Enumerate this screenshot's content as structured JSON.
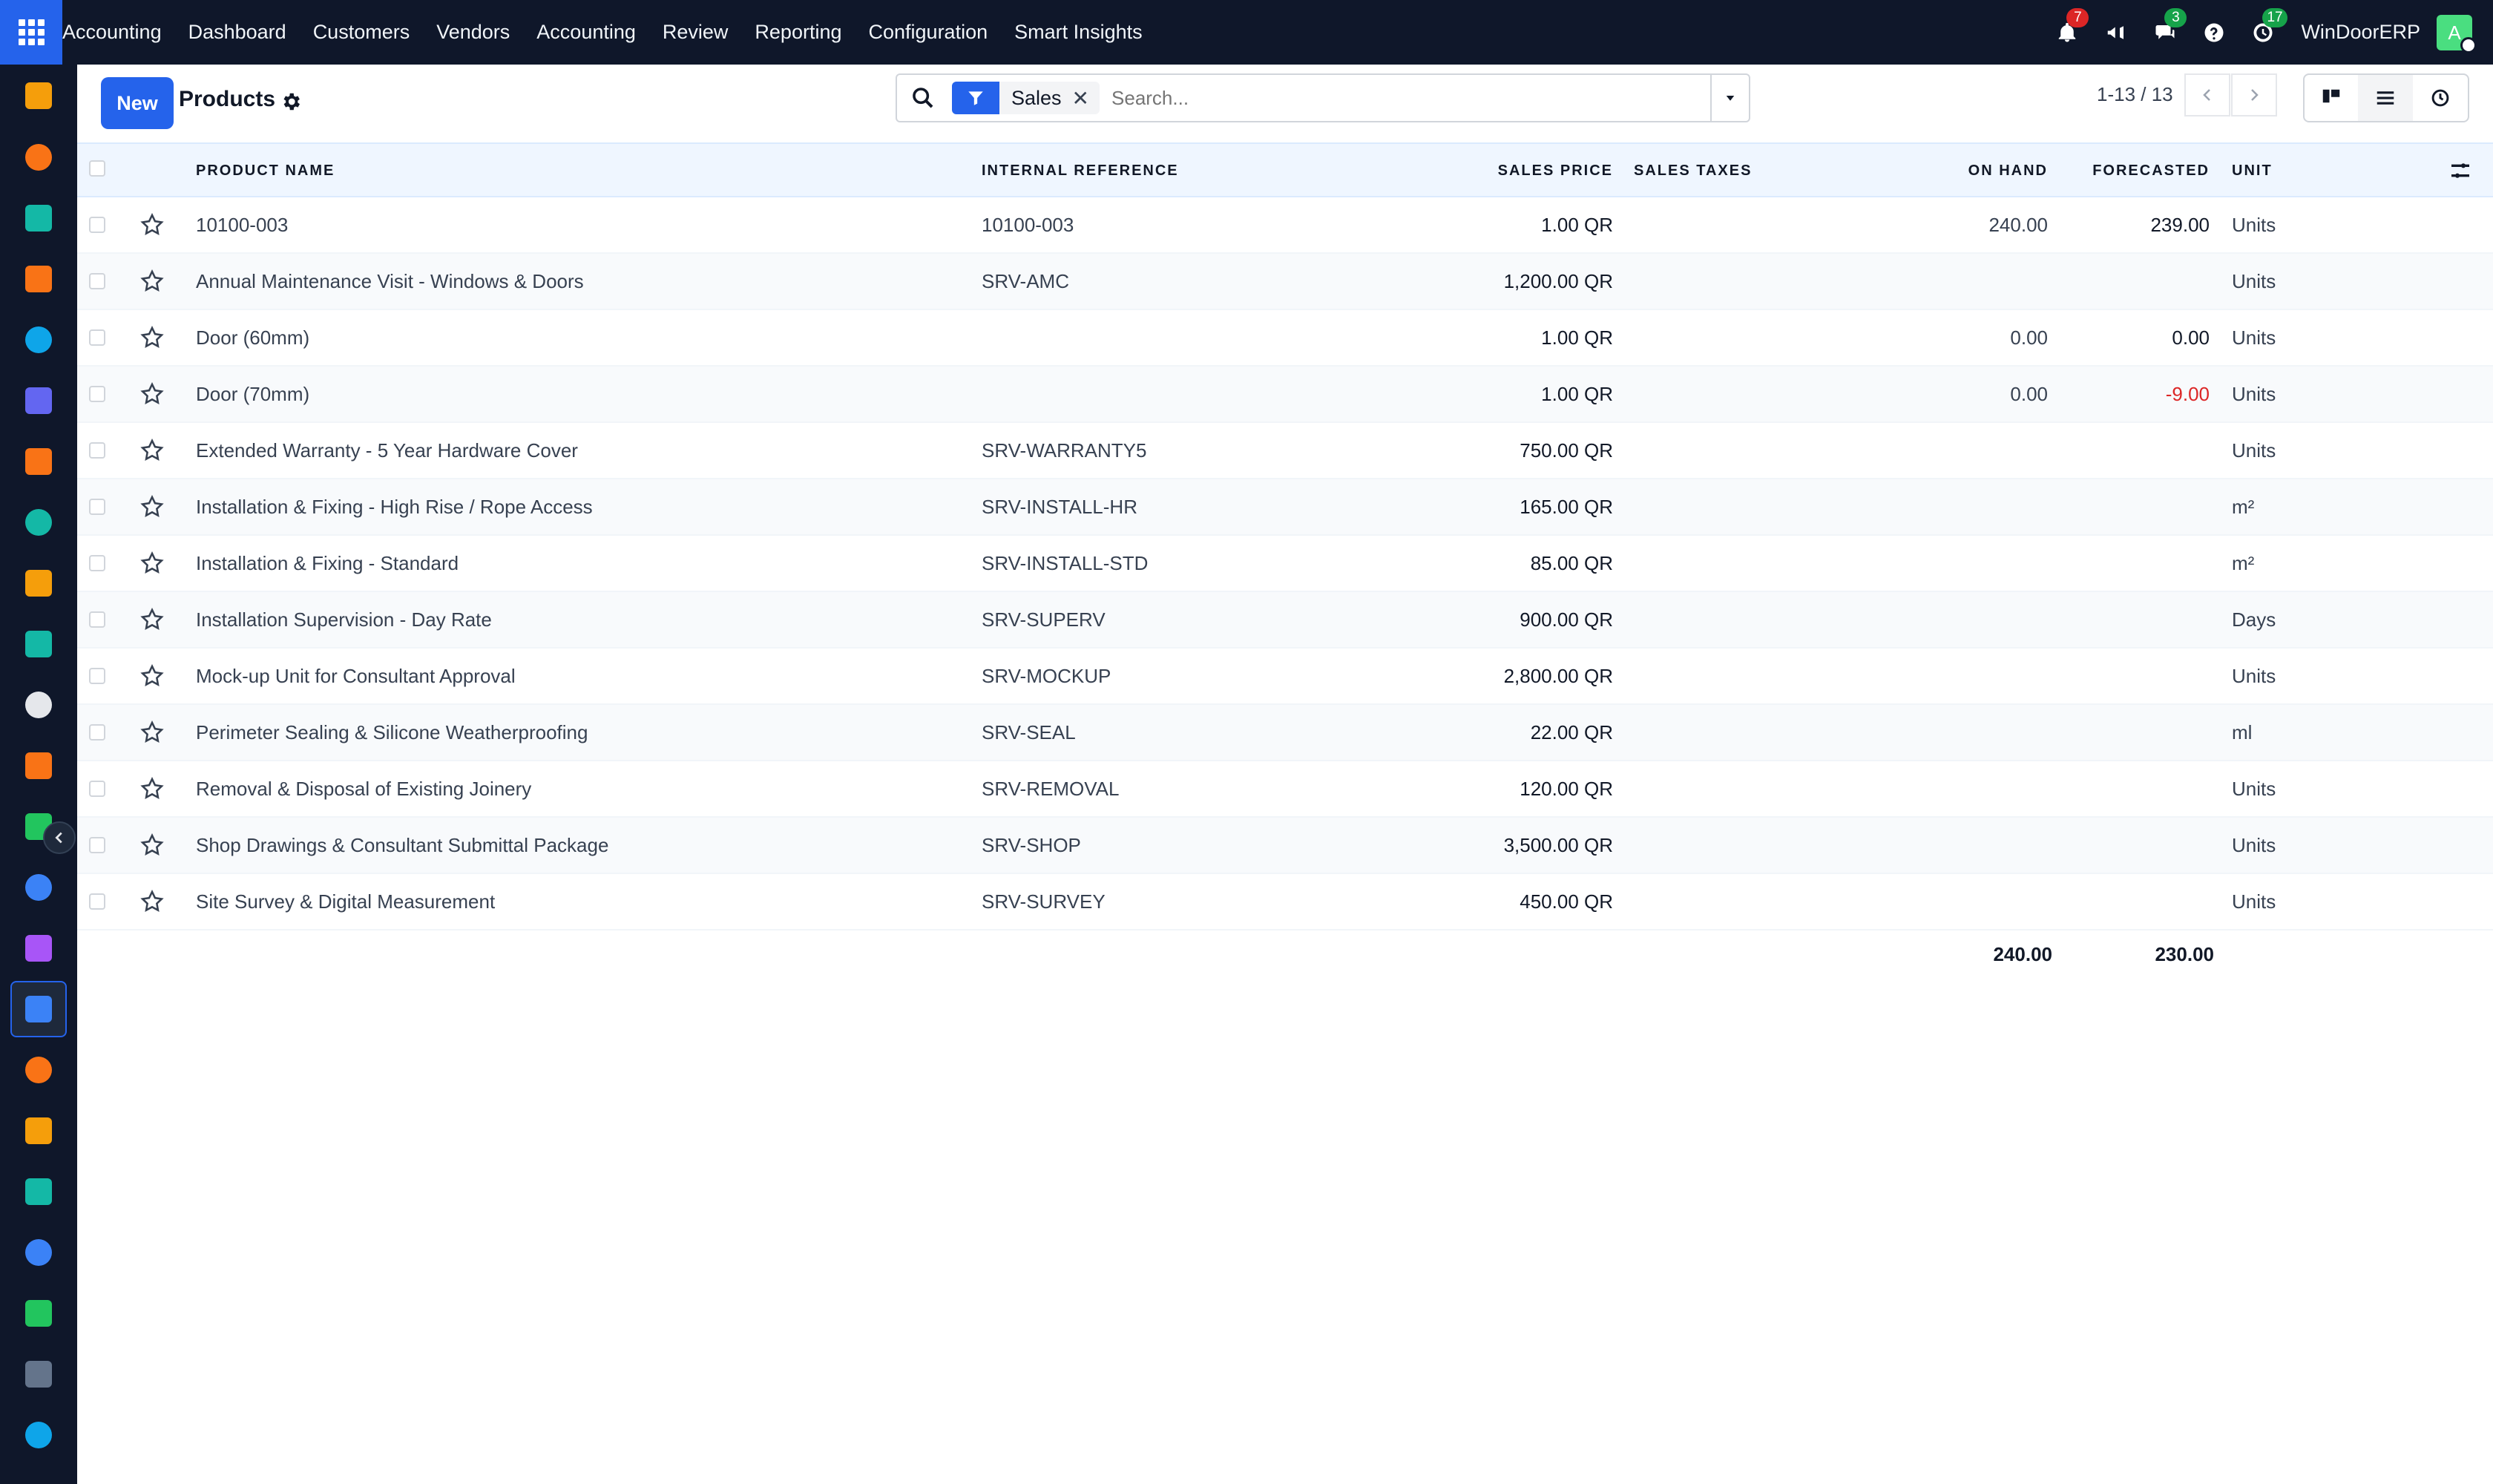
{
  "topbar": {
    "brand": "Accounting",
    "menu": [
      "Dashboard",
      "Customers",
      "Vendors",
      "Accounting",
      "Review",
      "Reporting",
      "Configuration",
      "Smart Insights"
    ],
    "notifications_count": "7",
    "messages_count": "3",
    "activities_count": "17",
    "company": "WinDoorERP",
    "avatar_letter": "A"
  },
  "sidebar": {
    "icons": [
      "accounting-icon",
      "studio-icon",
      "contacts-icon",
      "discuss-icon",
      "odoo-icon",
      "mail-icon",
      "chat-icon",
      "project-icon",
      "reporting-icon",
      "contacts-icon",
      "inventory-icon",
      "settings-icon",
      "todo-icon",
      "knowledge-icon",
      "package-icon",
      "invoicing-icon",
      "employees-icon",
      "calendar-icon",
      "sign-icon",
      "dashboards-icon",
      "whatsapp-icon",
      "timer-icon",
      "app-icon"
    ],
    "colors": [
      "#f59e0b",
      "#f97316",
      "#14b8a6",
      "#f97316",
      "#0ea5e9",
      "#6366f1",
      "#f97316",
      "#14b8a6",
      "#f59e0b",
      "#14b8a6",
      "#e5e7eb",
      "#f97316",
      "#22c55e",
      "#3b82f6",
      "#a855f7",
      "#3b82f6",
      "#f97316",
      "#f59e0b",
      "#14b8a6",
      "#3b82f6",
      "#22c55e",
      "#64748b",
      "#0ea5e9"
    ]
  },
  "control": {
    "new_label": "New",
    "title": "Products",
    "facet_label": "Sales",
    "search_placeholder": "Search...",
    "pager": "1-13 / 13"
  },
  "table": {
    "columns": [
      "Product Name",
      "Internal Reference",
      "Sales Price",
      "Sales Taxes",
      "On Hand",
      "Forecasted",
      "Unit"
    ],
    "rows": [
      {
        "name": "10100-003",
        "ref": "10100-003",
        "price": "1.00 QR",
        "taxes": "",
        "onhand": "240.00",
        "forecast": "239.00",
        "unit": "Units"
      },
      {
        "name": "Annual Maintenance Visit - Windows & Doors",
        "ref": "SRV-AMC",
        "price": "1,200.00 QR",
        "taxes": "",
        "onhand": "",
        "forecast": "",
        "unit": "Units"
      },
      {
        "name": "Door (60mm)",
        "ref": "",
        "price": "1.00 QR",
        "taxes": "",
        "onhand": "0.00",
        "forecast": "0.00",
        "unit": "Units"
      },
      {
        "name": "Door (70mm)",
        "ref": "",
        "price": "1.00 QR",
        "taxes": "",
        "onhand": "0.00",
        "forecast": "-9.00",
        "unit": "Units"
      },
      {
        "name": "Extended Warranty - 5 Year Hardware Cover",
        "ref": "SRV-WARRANTY5",
        "price": "750.00 QR",
        "taxes": "",
        "onhand": "",
        "forecast": "",
        "unit": "Units"
      },
      {
        "name": "Installation & Fixing - High Rise / Rope Access",
        "ref": "SRV-INSTALL-HR",
        "price": "165.00 QR",
        "taxes": "",
        "onhand": "",
        "forecast": "",
        "unit": "m²"
      },
      {
        "name": "Installation & Fixing - Standard",
        "ref": "SRV-INSTALL-STD",
        "price": "85.00 QR",
        "taxes": "",
        "onhand": "",
        "forecast": "",
        "unit": "m²"
      },
      {
        "name": "Installation Supervision - Day Rate",
        "ref": "SRV-SUPERV",
        "price": "900.00 QR",
        "taxes": "",
        "onhand": "",
        "forecast": "",
        "unit": "Days"
      },
      {
        "name": "Mock-up Unit for Consultant Approval",
        "ref": "SRV-MOCKUP",
        "price": "2,800.00 QR",
        "taxes": "",
        "onhand": "",
        "forecast": "",
        "unit": "Units"
      },
      {
        "name": "Perimeter Sealing & Silicone Weatherproofing",
        "ref": "SRV-SEAL",
        "price": "22.00 QR",
        "taxes": "",
        "onhand": "",
        "forecast": "",
        "unit": "ml"
      },
      {
        "name": "Removal & Disposal of Existing Joinery",
        "ref": "SRV-REMOVAL",
        "price": "120.00 QR",
        "taxes": "",
        "onhand": "",
        "forecast": "",
        "unit": "Units"
      },
      {
        "name": "Shop Drawings & Consultant Submittal Package",
        "ref": "SRV-SHOP",
        "price": "3,500.00 QR",
        "taxes": "",
        "onhand": "",
        "forecast": "",
        "unit": "Units"
      },
      {
        "name": "Site Survey & Digital Measurement",
        "ref": "SRV-SURVEY",
        "price": "450.00 QR",
        "taxes": "",
        "onhand": "",
        "forecast": "",
        "unit": "Units"
      }
    ],
    "totals": {
      "onhand": "240.00",
      "forecast": "230.00"
    }
  }
}
